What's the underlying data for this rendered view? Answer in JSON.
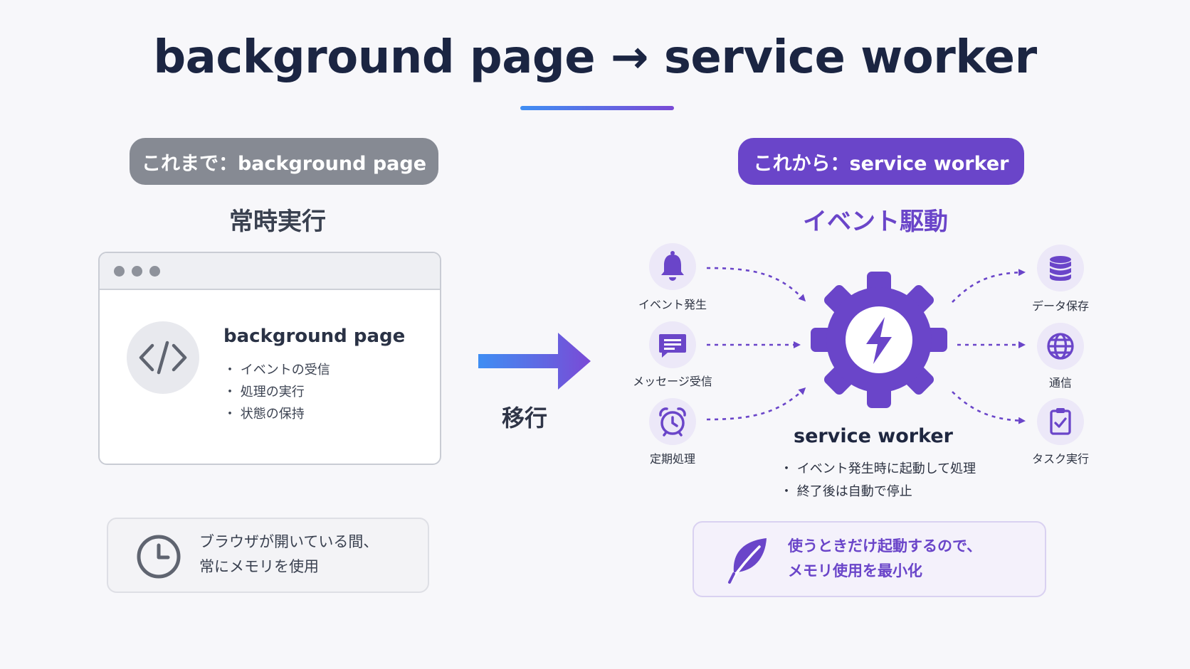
{
  "title": "background page → service worker",
  "left": {
    "pill": "これまで：background page",
    "heading": "常時実行",
    "browser_card": {
      "title": "background page",
      "items": [
        "・ イベントの受信",
        "・ 処理の実行",
        "・ 状態の保持"
      ],
      "icon": "code-icon"
    },
    "note": {
      "icon": "clock-icon",
      "lines": [
        "ブラウザが開いている間、",
        "常にメモリを使用"
      ]
    }
  },
  "migrate_label": "移行",
  "right": {
    "pill": "これから：service worker",
    "heading": "イベント駆動",
    "triggers": [
      {
        "label": "イベント発生",
        "icon": "bell-icon"
      },
      {
        "label": "メッセージ受信",
        "icon": "message-icon"
      },
      {
        "label": "定期処理",
        "icon": "alarm-clock-icon"
      }
    ],
    "center": {
      "icon": "gear-lightning-icon",
      "title": "service worker",
      "items": [
        "・ イベント発生時に起動して処理",
        "・ 終了後は自動で停止"
      ]
    },
    "outputs": [
      {
        "label": "データ保存",
        "icon": "database-icon"
      },
      {
        "label": "通信",
        "icon": "globe-icon"
      },
      {
        "label": "タスク実行",
        "icon": "clipboard-check-icon"
      }
    ],
    "note": {
      "icon": "leaf-icon",
      "lines": [
        "使うときだけ起動するので、",
        "メモリ使用を最小化"
      ]
    }
  },
  "colors": {
    "accent": "#6a45c9",
    "gray_pill": "#868a93",
    "title": "#1b2542",
    "arrow_start": "#3f8ef3",
    "arrow_end": "#7a4ad6"
  }
}
